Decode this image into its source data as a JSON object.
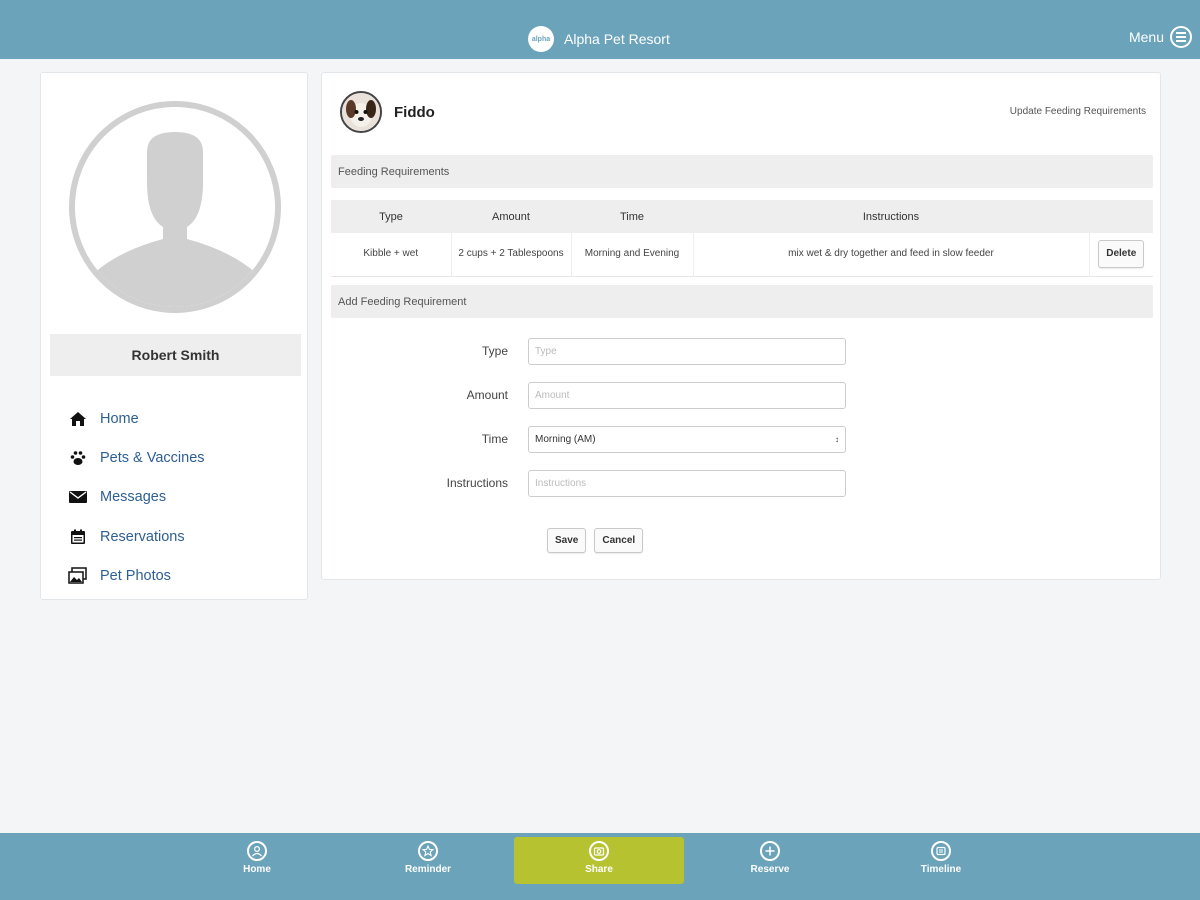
{
  "header": {
    "logo_text": "alpha",
    "brand": "Alpha Pet Resort",
    "menu_label": "Menu"
  },
  "sidebar": {
    "user_name": "Robert Smith",
    "items": [
      {
        "label": "Home",
        "icon": "home-icon"
      },
      {
        "label": "Pets & Vaccines",
        "icon": "paw-icon"
      },
      {
        "label": "Messages",
        "icon": "envelope-icon"
      },
      {
        "label": "Reservations",
        "icon": "calendar-icon"
      },
      {
        "label": "Pet Photos",
        "icon": "photos-icon"
      }
    ]
  },
  "main": {
    "pet_name": "Fiddo",
    "page_action": "Update Feeding Requirements",
    "feeding_title": "Feeding Requirements",
    "table": {
      "headers": [
        "Type",
        "Amount",
        "Time",
        "Instructions",
        ""
      ],
      "rows": [
        {
          "type": "Kibble + wet",
          "amount": "2 cups + 2 Tablespoons",
          "time": "Morning and Evening",
          "instructions": "mix wet & dry together and feed in slow feeder",
          "action": "Delete"
        }
      ]
    },
    "add_title": "Add Feeding Requirement",
    "form": {
      "type_label": "Type",
      "type_placeholder": "Type",
      "amount_label": "Amount",
      "amount_placeholder": "Amount",
      "time_label": "Time",
      "time_value": "Morning (AM)",
      "instructions_label": "Instructions",
      "instructions_placeholder": "Instructions",
      "save_label": "Save",
      "cancel_label": "Cancel"
    }
  },
  "bottom_nav": {
    "active_tab": "Share",
    "active_color": "#b7c231",
    "bar_color": "#6aa3ba",
    "tabs": [
      {
        "label": "Home",
        "icon": "user-circle-icon"
      },
      {
        "label": "Reminder",
        "icon": "star-icon"
      },
      {
        "label": "Share",
        "icon": "camera-icon"
      },
      {
        "label": "Reserve",
        "icon": "plus-circle-icon"
      },
      {
        "label": "Timeline",
        "icon": "timeline-icon"
      }
    ]
  }
}
